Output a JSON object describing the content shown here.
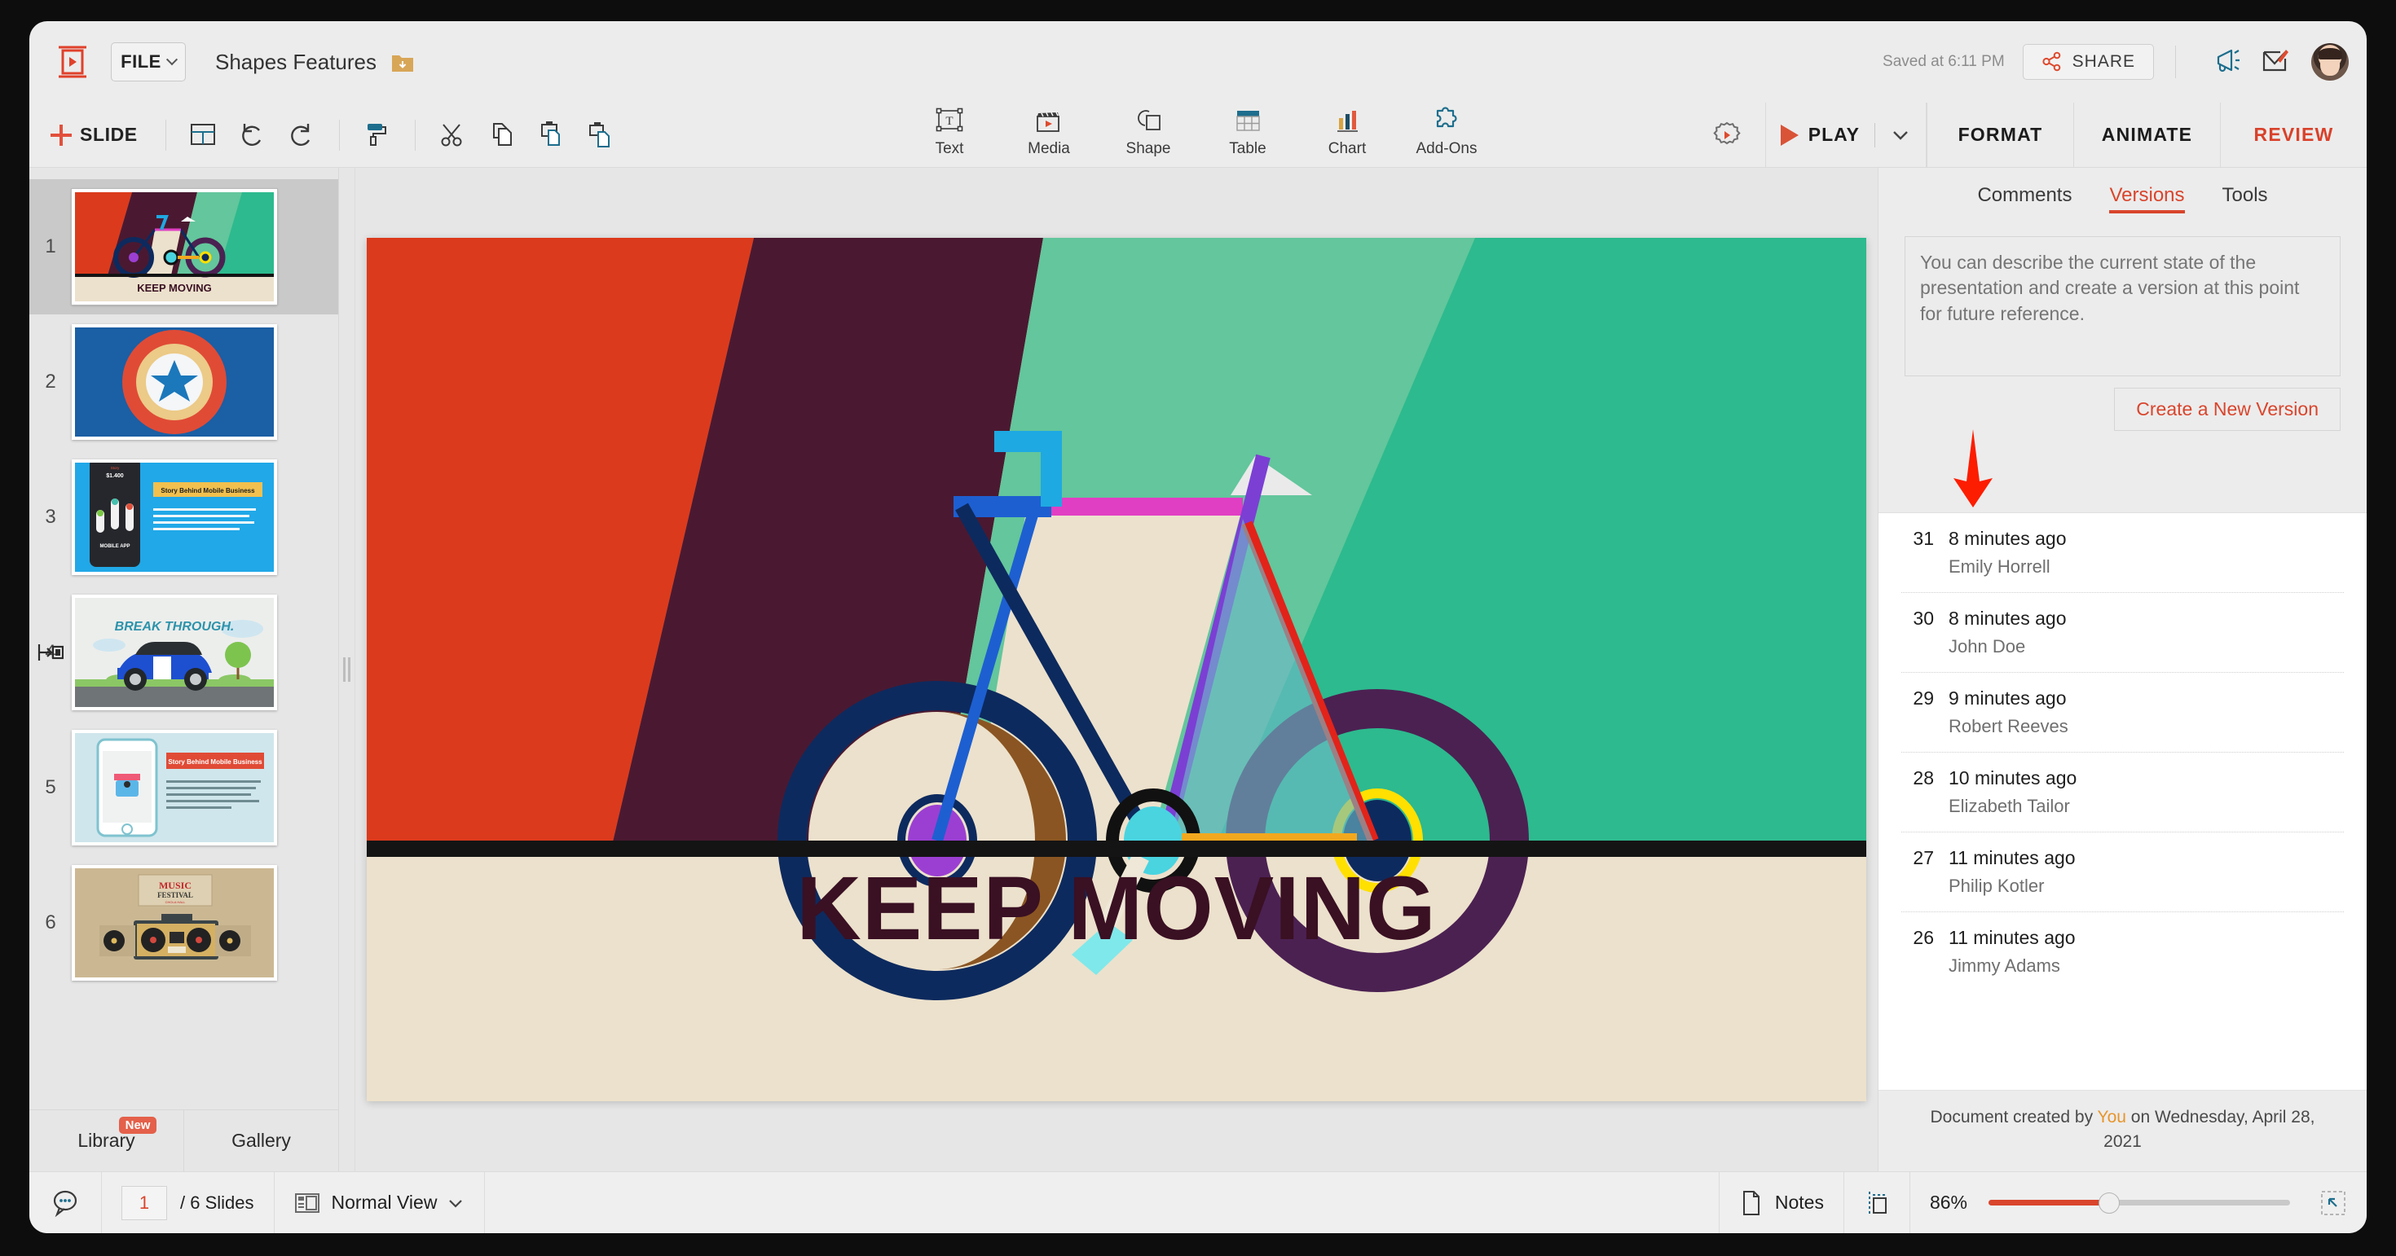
{
  "app": {
    "logo_icon": "presentation-play-logo-icon",
    "file_menu_label": "FILE",
    "document_title": "Shapes Features",
    "folder_icon": "folder-download-icon",
    "saved_status": "Saved at 6:11 PM",
    "share_label": "SHARE",
    "share_icon": "share-nodes-icon",
    "announce_icon": "megaphone-icon",
    "feedback_icon": "edit-note-icon",
    "avatar_icon": "user-avatar"
  },
  "ribbon": {
    "add_slide_label": "SLIDE",
    "left_icons": [
      {
        "name": "layout-icon"
      },
      {
        "name": "undo-icon"
      },
      {
        "name": "redo-icon"
      },
      {
        "name": "format-painter-icon"
      },
      {
        "name": "cut-scissors-icon"
      },
      {
        "name": "copy-icon"
      },
      {
        "name": "paste-icon"
      },
      {
        "name": "paste-special-icon"
      }
    ],
    "tools": [
      {
        "label": "Text",
        "icon": "text-box-icon"
      },
      {
        "label": "Media",
        "icon": "media-clapperboard-icon"
      },
      {
        "label": "Shape",
        "icon": "shape-icon"
      },
      {
        "label": "Table",
        "icon": "table-icon"
      },
      {
        "label": "Chart",
        "icon": "bar-chart-icon"
      },
      {
        "label": "Add-Ons",
        "icon": "puzzle-piece-icon"
      }
    ],
    "settings_icon": "gear-play-icon",
    "play_label": "PLAY",
    "play_caret_icon": "chevron-down-icon",
    "tabs": [
      {
        "label": "FORMAT",
        "active": false
      },
      {
        "label": "ANIMATE",
        "active": false
      },
      {
        "label": "REVIEW",
        "active": true
      }
    ],
    "accent_color": "#d9452c"
  },
  "slide_panel": {
    "slides": [
      {
        "number": "1",
        "title": "KEEP MOVING",
        "selected": true,
        "has_transition": false
      },
      {
        "number": "2",
        "title": "",
        "selected": false,
        "has_transition": false
      },
      {
        "number": "3",
        "title": "Story Behind Mobile Business",
        "selected": false,
        "has_transition": false
      },
      {
        "number": "4",
        "title": "BREAK THROUGH.",
        "selected": false,
        "has_transition": true
      },
      {
        "number": "5",
        "title": "Story Behind Mobile Business",
        "selected": false,
        "has_transition": false
      },
      {
        "number": "6",
        "title": "MUSIC FESTIVAL",
        "selected": false,
        "has_transition": false
      }
    ],
    "tabs": [
      {
        "label": "Library",
        "badge": "New"
      },
      {
        "label": "Gallery",
        "badge": ""
      }
    ]
  },
  "slide": {
    "headline": "KEEP MOVING",
    "headline_color": "#3a1023",
    "background_color": "#ece1cc",
    "palette": {
      "red": "#dc3a1c",
      "red_light": "#e2907f",
      "maroon": "#4a1931",
      "green": "#63c69c",
      "green_dark": "#2dba8e",
      "cream": "#ece1cc",
      "magenta": "#e13fc3",
      "navy": "#0d2a5e",
      "purple": "#9b3fd2",
      "yellow": "#ffe000",
      "orange": "#f2a81e",
      "cyan": "#49d4e0",
      "blue": "#1e6fd9",
      "sky": "#1ea9e2",
      "brown": "#8a5522",
      "plum": "#4b2152"
    }
  },
  "right_panel": {
    "tabs": [
      {
        "label": "Comments",
        "active": false
      },
      {
        "label": "Versions",
        "active": true
      },
      {
        "label": "Tools",
        "active": false
      }
    ],
    "description_placeholder": "You can describe the current state of the presentation and create a version at this point for future reference.",
    "description_value": "",
    "create_button_label": "Create a New Version",
    "annotation_icon": "red-down-arrow-annotation",
    "versions": [
      {
        "number": "31",
        "time": "8 minutes ago",
        "author": "Emily Horrell"
      },
      {
        "number": "30",
        "time": "8 minutes ago",
        "author": "John Doe"
      },
      {
        "number": "29",
        "time": "9 minutes ago",
        "author": "Robert Reeves"
      },
      {
        "number": "28",
        "time": "10 minutes ago",
        "author": "Elizabeth Tailor"
      },
      {
        "number": "27",
        "time": "11 minutes ago",
        "author": "Philip Kotler"
      },
      {
        "number": "26",
        "time": "11 minutes ago",
        "author": "Jimmy Adams"
      }
    ],
    "footer_prefix": "Document created by ",
    "footer_you": "You",
    "footer_suffix": " on Wednesday, April 28, 2021"
  },
  "status_bar": {
    "comments_icon": "comment-bubble-icon",
    "current_page": "1",
    "page_total": "/ 6 Slides",
    "view_icon": "normal-view-icon",
    "view_label": "Normal View",
    "view_caret_icon": "chevron-down-icon",
    "notes_icon": "notes-page-icon",
    "notes_label": "Notes",
    "guides_icon": "guides-icon",
    "zoom_level": "86%",
    "zoom_percent": 40,
    "fit_icon": "fit-to-screen-icon"
  }
}
